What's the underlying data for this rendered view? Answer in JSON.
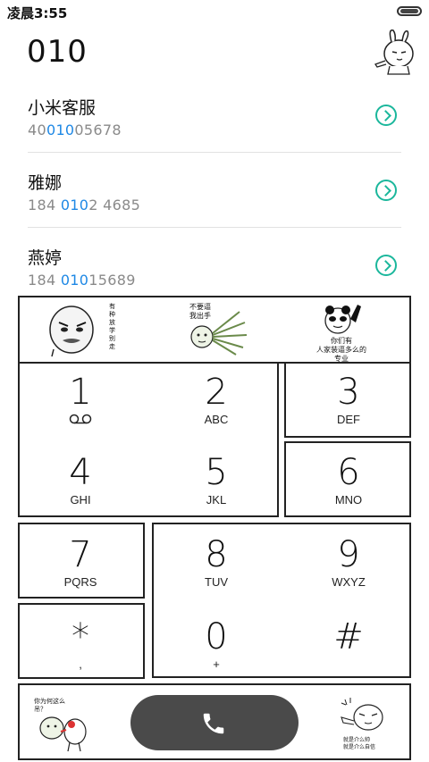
{
  "status_bar": {
    "time": "凌晨3:55"
  },
  "dial_input": "010",
  "contacts": [
    {
      "name": "小米客服",
      "number_pre": "40",
      "number_hl": "010",
      "number_post": "05678"
    },
    {
      "name": "雅娜",
      "number_pre": "184 ",
      "number_hl": "010",
      "number_post": "2 4685"
    },
    {
      "name": "燕婷",
      "number_pre": "184 ",
      "number_hl": "010",
      "number_post": "15689"
    }
  ],
  "stickers": {
    "top_left_text": "有\n种\n放\n学\n别\n走",
    "top_mid_text": "不要逼\n我出手",
    "top_right_text": "你们有\n人家装逼多么的\n专业",
    "bottom_left_text": "你为何这么\n吊？",
    "bottom_right_text": "就是介么帅\n就是介么自信"
  },
  "keypad": [
    {
      "digit": "1",
      "letters": ""
    },
    {
      "digit": "2",
      "letters": "ABC"
    },
    {
      "digit": "3",
      "letters": "DEF"
    },
    {
      "digit": "4",
      "letters": "GHI"
    },
    {
      "digit": "5",
      "letters": "JKL"
    },
    {
      "digit": "6",
      "letters": "MNO"
    },
    {
      "digit": "7",
      "letters": "PQRS"
    },
    {
      "digit": "8",
      "letters": "TUV"
    },
    {
      "digit": "9",
      "letters": "WXYZ"
    },
    {
      "digit": "*",
      "letters": ","
    },
    {
      "digit": "0",
      "letters": "+"
    },
    {
      "digit": "#",
      "letters": ""
    }
  ],
  "colors": {
    "highlight": "#1e88e5",
    "arrow": "#1bb79c",
    "call_button": "#4a4a4a"
  },
  "icons": {
    "voicemail": "voicemail-icon",
    "call": "phone-icon",
    "contact_arrow": "chevron-right-circle-icon"
  }
}
